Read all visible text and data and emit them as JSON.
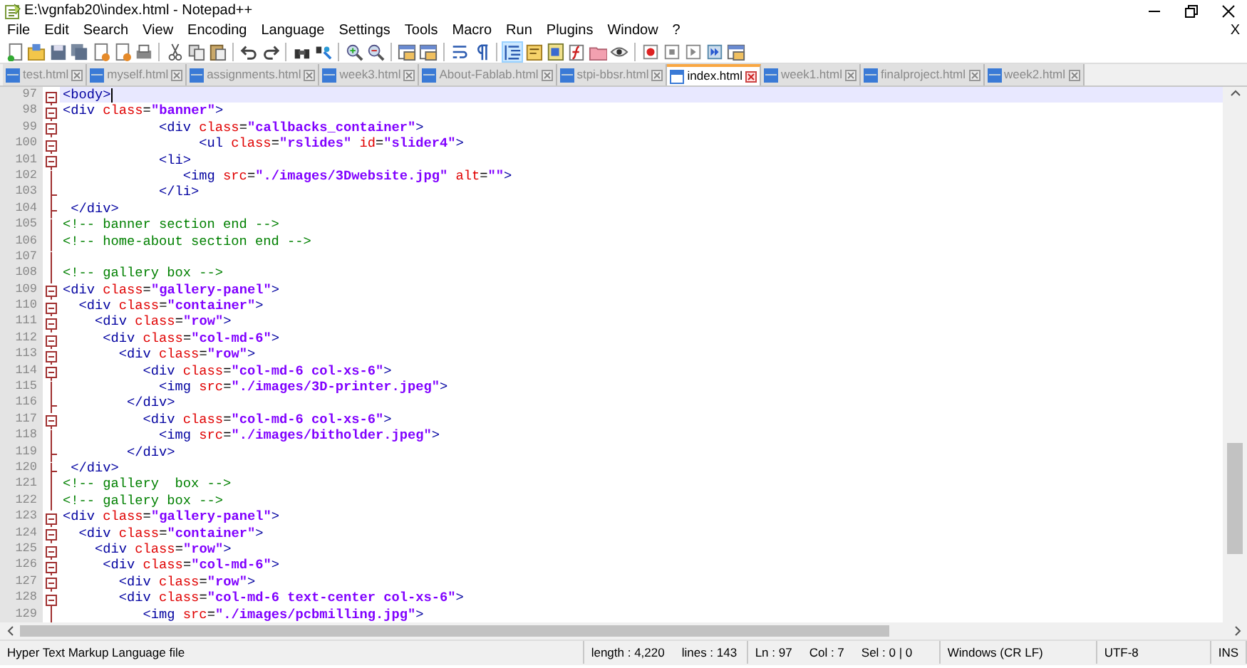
{
  "window": {
    "title": "E:\\vgnfab20\\index.html - Notepad++"
  },
  "menu": [
    "File",
    "Edit",
    "Search",
    "View",
    "Encoding",
    "Language",
    "Settings",
    "Tools",
    "Macro",
    "Run",
    "Plugins",
    "Window",
    "?"
  ],
  "doc_close": "X",
  "toolbar": [
    {
      "pressed": false
    },
    {
      "pressed": false
    },
    {
      "pressed": false
    },
    {
      "pressed": false
    },
    {
      "pressed": false
    },
    {
      "pressed": false
    },
    {
      "pressed": false
    },
    {
      "pressed": false
    },
    {
      "pressed": false
    },
    {
      "pressed": false
    },
    {
      "pressed": false
    },
    {
      "pressed": false
    },
    {
      "pressed": false
    },
    {
      "pressed": false
    },
    {
      "pressed": false
    },
    {
      "pressed": false
    },
    {
      "pressed": false
    },
    {
      "pressed": false
    },
    {
      "pressed": false
    },
    {
      "pressed": false
    },
    {
      "pressed": true
    },
    {
      "pressed": false
    },
    {
      "pressed": false
    },
    {
      "pressed": false
    },
    {
      "pressed": false
    },
    {
      "pressed": false
    },
    {
      "pressed": false
    },
    {
      "pressed": false
    },
    {
      "pressed": false
    },
    {
      "pressed": false
    },
    {
      "pressed": false
    }
  ],
  "tabs": [
    {
      "label": "test.html",
      "selected": false
    },
    {
      "label": "myself.html",
      "selected": false
    },
    {
      "label": "assignments.html",
      "selected": false
    },
    {
      "label": "week3.html",
      "selected": false
    },
    {
      "label": "About-Fablab.html",
      "selected": false
    },
    {
      "label": "stpi-bbsr.html",
      "selected": false
    },
    {
      "label": "index.html",
      "selected": true
    },
    {
      "label": "week1.html",
      "selected": false
    },
    {
      "label": "finalproject.html",
      "selected": false
    },
    {
      "label": "week2.html",
      "selected": false
    }
  ],
  "lines": [
    {
      "number": "97",
      "text": "<body>",
      "kind": "open",
      "current": true
    },
    {
      "number": "98",
      "text": "<div class=\"banner\">",
      "kind": "open",
      "current": false
    },
    {
      "number": "99",
      "text": "            <div class=\"callbacks_container\">",
      "kind": "open",
      "current": false
    },
    {
      "number": "100",
      "text": "                 <ul class=\"rslides\" id=\"slider4\">",
      "kind": "open",
      "current": false
    },
    {
      "number": "101",
      "text": "            <li>",
      "kind": "open",
      "current": false
    },
    {
      "number": "102",
      "text": "               <img src=\"./images/3Dwebsite.jpg\" alt=\"\">",
      "kind": "line",
      "current": false
    },
    {
      "number": "103",
      "text": "            </li>",
      "kind": "end",
      "current": false
    },
    {
      "number": "104",
      "text": " </div>",
      "kind": "end",
      "current": false
    },
    {
      "number": "105",
      "text": "<!-- banner section end -->",
      "kind": "line",
      "current": false
    },
    {
      "number": "106",
      "text": "<!-- home-about section end -->",
      "kind": "line",
      "current": false
    },
    {
      "number": "107",
      "kind": "line",
      "current": false
    },
    {
      "number": "108",
      "text": "<!-- gallery box -->",
      "kind": "line",
      "current": false
    },
    {
      "number": "109",
      "text": "<div class=\"gallery-panel\">",
      "kind": "open",
      "current": false
    },
    {
      "number": "110",
      "text": "  <div class=\"container\">",
      "kind": "open",
      "current": false
    },
    {
      "number": "111",
      "text": "    <div class=\"row\">",
      "kind": "open",
      "current": false
    },
    {
      "number": "112",
      "text": "     <div class=\"col-md-6\">",
      "kind": "open",
      "current": false
    },
    {
      "number": "113",
      "text": "       <div class=\"row\">",
      "kind": "open",
      "current": false
    },
    {
      "number": "114",
      "text": "          <div class=\"col-md-6 col-xs-6\">",
      "kind": "open",
      "current": false
    },
    {
      "number": "115",
      "text": "            <img src=\"./images/3D-printer.jpeg\">",
      "kind": "line",
      "current": false
    },
    {
      "number": "116",
      "text": "        </div>",
      "kind": "end",
      "current": false
    },
    {
      "number": "117",
      "text": "          <div class=\"col-md-6 col-xs-6\">",
      "kind": "open",
      "current": false
    },
    {
      "number": "118",
      "text": "            <img src=\"./images/bitholder.jpeg\">",
      "kind": "line",
      "current": false
    },
    {
      "number": "119",
      "text": "        </div>",
      "kind": "end",
      "current": false
    },
    {
      "number": "120",
      "text": " </div>",
      "kind": "end",
      "current": false
    },
    {
      "number": "121",
      "text": "<!-- gallery  box -->",
      "kind": "line",
      "current": false
    },
    {
      "number": "122",
      "text": "<!-- gallery box -->",
      "kind": "line",
      "current": false
    },
    {
      "number": "123",
      "text": "<div class=\"gallery-panel\">",
      "kind": "open",
      "current": false
    },
    {
      "number": "124",
      "text": "  <div class=\"container\">",
      "kind": "open",
      "current": false
    },
    {
      "number": "125",
      "text": "    <div class=\"row\">",
      "kind": "open",
      "current": false
    },
    {
      "number": "126",
      "text": "     <div class=\"col-md-6\">",
      "kind": "open",
      "current": false
    },
    {
      "number": "127",
      "text": "       <div class=\"row\">",
      "kind": "open",
      "current": false
    },
    {
      "number": "128",
      "text": "       <div class=\"col-md-6 text-center col-xs-6\">",
      "kind": "open",
      "current": false
    },
    {
      "number": "129",
      "text": "          <img src=\"./images/pcbmilling.jpg\">",
      "kind": "line",
      "current": false
    }
  ],
  "status_bar": [
    {
      "texts": [
        "Hyper Text Markup Language file"
      ]
    },
    {
      "texts": [
        "length : 4,220",
        "lines : 143"
      ]
    },
    {
      "texts": [
        "Ln : 97",
        "Col : 7",
        "Sel : 0 | 0"
      ]
    },
    {
      "texts": [
        "Windows (CR LF)"
      ]
    },
    {
      "texts": [
        "UTF-8"
      ]
    },
    {
      "texts": [
        "INS"
      ]
    }
  ]
}
